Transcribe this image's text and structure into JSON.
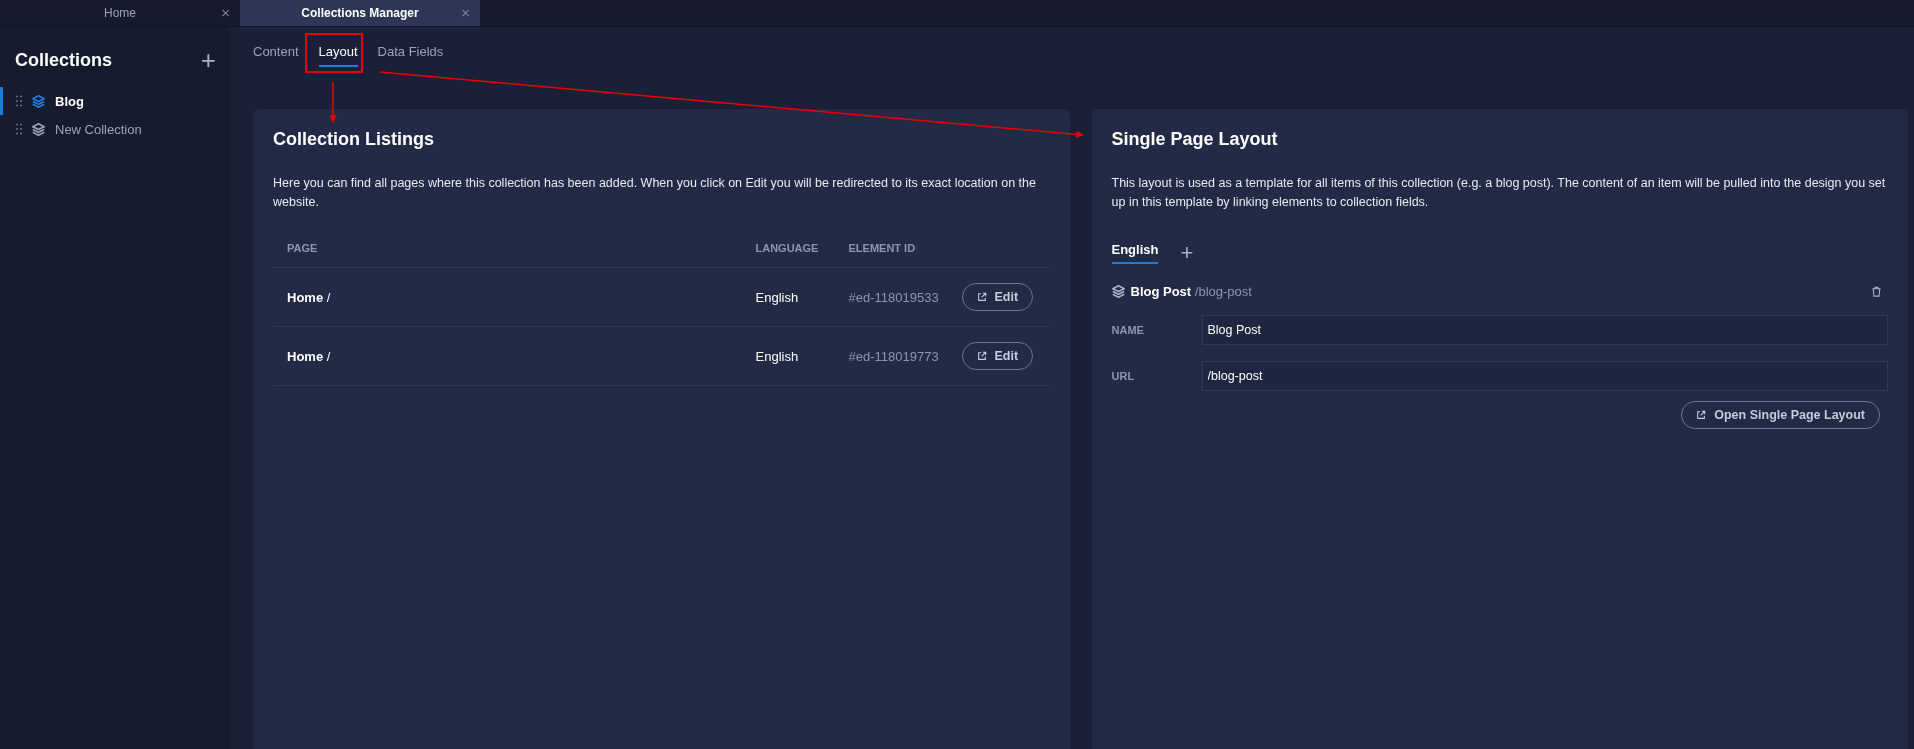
{
  "window_tabs": [
    {
      "label": "Home",
      "close": "×",
      "selected": false
    },
    {
      "label": "Collections Manager",
      "close": "×",
      "selected": true
    }
  ],
  "sidebar": {
    "title": "Collections",
    "add": "+",
    "items": [
      {
        "label": "Blog",
        "selected": true
      },
      {
        "label": "New Collection",
        "selected": false
      }
    ]
  },
  "tabs": [
    {
      "label": "Content",
      "selected": false
    },
    {
      "label": "Layout",
      "selected": true
    },
    {
      "label": "Data Fields",
      "selected": false
    }
  ],
  "listings": {
    "title": "Collection Listings",
    "description": "Here you can find all pages where this collection has been added. When you click on Edit you will be redirected to its exact location on the website.",
    "columns": [
      "PAGE",
      "LANGUAGE",
      "ELEMENT ID"
    ],
    "rows": [
      {
        "page": "Home",
        "path": "/",
        "language": "English",
        "element_id": "#ed-118019533",
        "action": "Edit"
      },
      {
        "page": "Home",
        "path": "/",
        "language": "English",
        "element_id": "#ed-118019773",
        "action": "Edit"
      }
    ]
  },
  "single_page": {
    "title": "Single Page Layout",
    "description": "This layout is used as a template for all items of this collection (e.g. a blog post). The content of an item will be pulled into the design you set up in this template by linking elements to collection fields.",
    "languages": [
      {
        "label": "English",
        "selected": true
      }
    ],
    "add_language": "+",
    "layout_name": "Blog Post",
    "layout_path": "/blog-post",
    "fields": [
      {
        "label": "NAME",
        "value": "Blog Post"
      },
      {
        "label": "URL",
        "value": "/blog-post"
      }
    ],
    "open_button": "Open Single Page Layout"
  }
}
